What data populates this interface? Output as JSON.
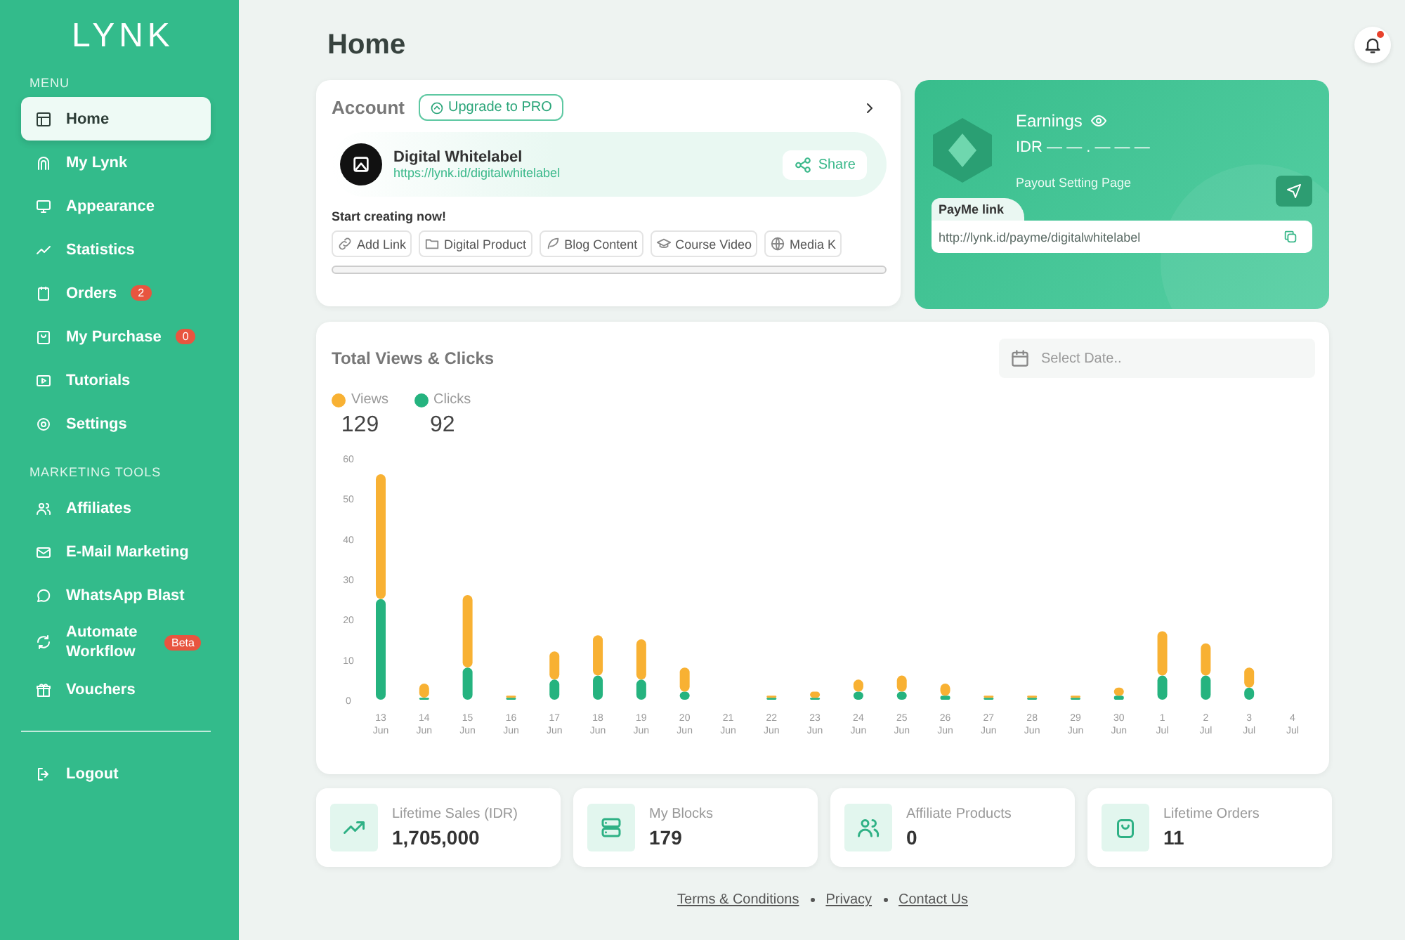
{
  "logo": "LYNK",
  "sidebar": {
    "sections": [
      {
        "heading": "MENU",
        "items": [
          {
            "label": "Home",
            "selected": true
          },
          {
            "label": "My Lynk",
            "selected": false
          },
          {
            "label": "Appearance",
            "selected": false
          },
          {
            "label": "Statistics",
            "selected": false
          },
          {
            "label": "Orders",
            "badge": "2",
            "selected": false
          },
          {
            "label": "My Purchase",
            "badge": "0",
            "selected": false
          },
          {
            "label": "Tutorials",
            "selected": false
          },
          {
            "label": "Settings",
            "selected": false
          }
        ]
      },
      {
        "heading": "MARKETING TOOLS",
        "items": [
          {
            "label": "Affiliates",
            "selected": false
          },
          {
            "label": "E-Mail Marketing",
            "selected": false
          },
          {
            "label": "WhatsApp Blast",
            "selected": false
          },
          {
            "label": "Automate Workflow",
            "badge": "Beta",
            "selected": false
          },
          {
            "label": "Vouchers",
            "selected": false
          }
        ]
      }
    ],
    "logout": "Logout"
  },
  "header": {
    "title": "Home",
    "notification_dot": true
  },
  "account": {
    "title": "Account",
    "upgrade": "Upgrade to PRO",
    "name": "Digital Whitelabel",
    "url": "https://lynk.id/digitalwhitelabel",
    "share": "Share",
    "prompt": "Start creating now!",
    "chips": [
      "Add Link",
      "Digital Product",
      "Blog Content",
      "Course Video",
      "Media K"
    ]
  },
  "earnings": {
    "title": "Earnings",
    "currency": "IDR",
    "amount": "— — . — — —",
    "payout": "Payout Setting Page",
    "payme_label": "PayMe link",
    "payme_url": "http://lynk.id/payme/digitalwhitelabel"
  },
  "stats_chart": {
    "title": "Total Views & Clicks",
    "date_placeholder": "Select Date..",
    "legend_totals": [
      "129",
      "92"
    ],
    "chart_data": {
      "type": "bar",
      "stacked": true,
      "categories": [
        "13 Jun",
        "14 Jun",
        "15 Jun",
        "16 Jun",
        "17 Jun",
        "18 Jun",
        "19 Jun",
        "20 Jun",
        "21 Jun",
        "22 Jun",
        "23 Jun",
        "24 Jun",
        "25 Jun",
        "26 Jun",
        "27 Jun",
        "28 Jun",
        "29 Jun",
        "30 Jun",
        "1 Jul",
        "2 Jul",
        "3 Jul",
        "4 Jul"
      ],
      "series": [
        {
          "name": "Views",
          "color": "#f8b133",
          "values": [
            31,
            3.5,
            18,
            0.5,
            7,
            10,
            10,
            6,
            0,
            0.5,
            1.5,
            3,
            4,
            3,
            0.5,
            0.5,
            0.5,
            2,
            11,
            8,
            5,
            0
          ]
        },
        {
          "name": "Clicks",
          "color": "#25b37f",
          "values": [
            25,
            0.5,
            8,
            0.5,
            5,
            6,
            5,
            2,
            0,
            0.5,
            0.5,
            2,
            2,
            1,
            0.5,
            0.5,
            0.5,
            1,
            6,
            6,
            3,
            0
          ]
        }
      ],
      "ylim": [
        0,
        60
      ],
      "yticks": [
        0,
        10,
        20,
        30,
        40,
        50,
        60
      ]
    }
  },
  "stats": [
    {
      "label": "Lifetime Sales (IDR)",
      "value": "1,705,000"
    },
    {
      "label": "My Blocks",
      "value": "179"
    },
    {
      "label": "Affiliate Products",
      "value": "0"
    },
    {
      "label": "Lifetime Orders",
      "value": "11"
    }
  ],
  "footer": [
    "Terms & Conditions",
    "Privacy",
    "Contact Us"
  ]
}
